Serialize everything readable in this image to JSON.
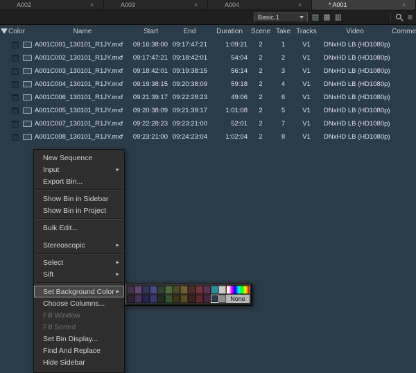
{
  "glyphs": {
    "close": "×",
    "submenu": "▸",
    "list_view": "▤",
    "frame_view": "▦",
    "script_view": "▥",
    "menu": "≡"
  },
  "colors": {
    "bin_bg": "#2c3b48",
    "tabbar_bg": "#262626",
    "active_tab_bg": "#3d3d3d",
    "toolbar_bg": "#1f1f1f",
    "menu_bg": "#2e2e2e",
    "menu_highlight_bg": "#474747",
    "text": "#d6dde3"
  },
  "tabs": [
    {
      "label": "A002",
      "active": false
    },
    {
      "label": "A003",
      "active": false
    },
    {
      "label": "A004",
      "active": false
    },
    {
      "label": "* A001",
      "active": true
    }
  ],
  "toolbar": {
    "view_preset": "Basic.1"
  },
  "table": {
    "columns": [
      "Color",
      "Name",
      "Start",
      "End",
      "Duration",
      "Scene",
      "Take",
      "Tracks",
      "Video",
      "Comments"
    ],
    "rows": [
      {
        "name": "A001C001_130101_R1JY.mxf",
        "start": "09:16:38:00",
        "end": "09:17:47:21",
        "duration": "1:09:21",
        "scene": "2",
        "take": "1",
        "tracks": "V1",
        "video": "DNxHD LB (HD1080p)"
      },
      {
        "name": "A001C002_130101_R1JY.mxf",
        "start": "09:17:47:21",
        "end": "09:18:42:01",
        "duration": "54:04",
        "scene": "2",
        "take": "2",
        "tracks": "V1",
        "video": "DNxHD LB (HD1080p)"
      },
      {
        "name": "A001C003_130101_R1JY.mxf",
        "start": "09:18:42:01",
        "end": "09:19:38:15",
        "duration": "56:14",
        "scene": "2",
        "take": "3",
        "tracks": "V1",
        "video": "DNxHD LB (HD1080p)"
      },
      {
        "name": "A001C004_130101_R1JY.mxf",
        "start": "09:19:38:15",
        "end": "09:20:38:09",
        "duration": "59:18",
        "scene": "2",
        "take": "4",
        "tracks": "V1",
        "video": "DNxHD LB (HD1080p)"
      },
      {
        "name": "A001C006_130101_R1JY.mxf",
        "start": "09:21:39:17",
        "end": "09:22:28:23",
        "duration": "49:06",
        "scene": "2",
        "take": "6",
        "tracks": "V1",
        "video": "DNxHD LB (HD1080p)"
      },
      {
        "name": "A001C005_130101_R1JY.mxf",
        "start": "09:20:38:09",
        "end": "09:21:39:17",
        "duration": "1:01:08",
        "scene": "2",
        "take": "5",
        "tracks": "V1",
        "video": "DNxHD LB (HD1080p)"
      },
      {
        "name": "A001C007_130101_R1JY.mxf",
        "start": "09:22:28:23",
        "end": "09:23:21:00",
        "duration": "52:01",
        "scene": "2",
        "take": "7",
        "tracks": "V1",
        "video": "DNxHD LB (HD1080p)"
      },
      {
        "name": "A001C008_130101_R1JY.mxf",
        "start": "09:23:21:00",
        "end": "09:24:23:04",
        "duration": "1:02:04",
        "scene": "2",
        "take": "8",
        "tracks": "V1",
        "video": "DNxHD LB (HD1080p)"
      }
    ]
  },
  "context_menu": {
    "items": [
      {
        "label": "New Sequence"
      },
      {
        "label": "Input",
        "submenu": true
      },
      {
        "label": "Export Bin..."
      },
      {
        "separator": true
      },
      {
        "label": "Show Bin in Sidebar"
      },
      {
        "label": "Show Bin in Project"
      },
      {
        "separator": true
      },
      {
        "label": "Bulk Edit..."
      },
      {
        "separator": true
      },
      {
        "label": "Stereoscopic",
        "submenu": true
      },
      {
        "separator": true
      },
      {
        "label": "Select",
        "submenu": true
      },
      {
        "label": "Sift",
        "submenu": true
      },
      {
        "separator": true
      },
      {
        "label": "Set Background Color",
        "submenu": true,
        "highlighted": true
      },
      {
        "label": "Choose Columns..."
      },
      {
        "label": "Fill Window",
        "disabled": true
      },
      {
        "label": "Fill Sorted",
        "disabled": true
      },
      {
        "label": "Set Bin Display..."
      },
      {
        "label": "Find And Replace"
      },
      {
        "label": "Hide Sidebar"
      }
    ]
  },
  "palette": {
    "row1": [
      "#3f3247",
      "#5e4671",
      "#343359",
      "#47477f",
      "#314030",
      "#4a6a40",
      "#4e472b",
      "#6e5f33",
      "#4b2d2d",
      "#723636",
      "#5d3351",
      "#2f8c9c",
      "#c9c9c9"
    ],
    "row2": [
      "#2b2133",
      "#463256",
      "#25254a",
      "#38386c",
      "#232f21",
      "#3a5431",
      "#3b3520",
      "#584b26",
      "#3a2121",
      "#5c2929",
      "#472640",
      "#2b3b4a",
      "#8f8f8f"
    ],
    "selected_index_row2": 11,
    "none_label": "None"
  }
}
